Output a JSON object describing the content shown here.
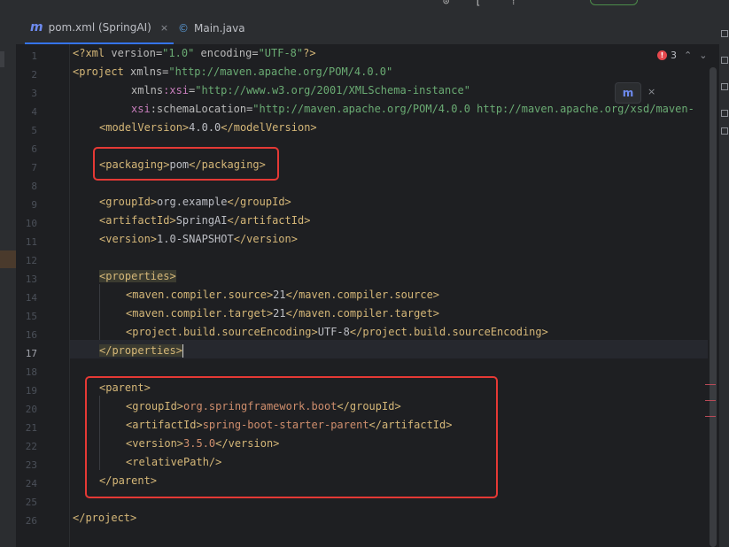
{
  "window": {
    "top_glyphs": [
      "⊙",
      "[",
      "⁞"
    ]
  },
  "tabs": [
    {
      "icon_label": "m",
      "label": "pom.xml (SpringAI)",
      "close": "×",
      "active": true
    },
    {
      "icon_label": "©",
      "label": "Main.java",
      "close": "",
      "active": false
    }
  ],
  "inspections": {
    "error_icon": "!",
    "error_count": "3",
    "up": "⌃",
    "down": "⌄"
  },
  "floating_toolbar": {
    "icon_label": "m",
    "close": "×"
  },
  "gutter": {
    "current_line": 17,
    "line_numbers": [
      "1",
      "2",
      "3",
      "4",
      "5",
      "6",
      "7",
      "8",
      "9",
      "10",
      "11",
      "12",
      "13",
      "14",
      "15",
      "16",
      "17",
      "18",
      "19",
      "20",
      "21",
      "22",
      "23",
      "24",
      "25",
      "26"
    ],
    "bulb": "💡"
  },
  "code": {
    "l1_a": "<?xml ",
    "l1_b": "version",
    "l1_c": "=",
    "l1_d": "\"1.0\"",
    "l1_e": " encoding",
    "l1_f": "=",
    "l1_g": "\"UTF-8\"",
    "l1_h": "?>",
    "l2_a": "<project ",
    "l2_b": "xmlns",
    "l2_c": "=",
    "l2_d": "\"http://maven.apache.org/POM/4.0.0\"",
    "l3_a": "xmlns",
    "l3_b": ":xsi",
    "l3_c": "=",
    "l3_d": "\"http://www.w3.org/2001/XMLSchema-instance\"",
    "l4_a": "xsi",
    "l4_b": ":schemaLocation",
    "l4_c": "=",
    "l4_d": "\"http://maven.apache.org/POM/4.0.0 http://maven.apache.org/xsd/maven-",
    "l5_a": "<modelVersion>",
    "l5_b": "4.0.0",
    "l5_c": "</modelVersion>",
    "l7_a": "<packaging>",
    "l7_b": "pom",
    "l7_c": "</packaging>",
    "l9_a": "<groupId>",
    "l9_b": "org.example",
    "l9_c": "</groupId>",
    "l10_a": "<artifactId>",
    "l10_b": "SpringAI",
    "l10_c": "</artifactId>",
    "l11_a": "<version>",
    "l11_b": "1.0-SNAPSHOT",
    "l11_c": "</version>",
    "l13_a": "<properties>",
    "l14_a": "<maven.compiler.source>",
    "l14_b": "21",
    "l14_c": "</maven.compiler.source>",
    "l15_a": "<maven.compiler.target>",
    "l15_b": "21",
    "l15_c": "</maven.compiler.target>",
    "l16_a": "<project.build.sourceEncoding>",
    "l16_b": "UTF-8",
    "l16_c": "</project.build.sourceEncoding>",
    "l17_a": "</properties>",
    "l19_a": "<parent>",
    "l20_a": "<groupId>",
    "l20_b": "org.springframework.boot",
    "l20_c": "</groupId>",
    "l21_a": "<artifactId>",
    "l21_b": "spring-boot-starter-parent",
    "l21_c": "</artifactId>",
    "l22_a": "<version>",
    "l22_b": "3.5.0",
    "l22_c": "</version>",
    "l23_a": "<relativePath/>",
    "l24_a": "</parent>",
    "l26_a": "</project>"
  },
  "colors": {
    "tag": "#d5b778",
    "attr_string": "#6aab73",
    "namespace": "#c77dbb",
    "unresolved_value": "#cf8e6d",
    "highlight_box": "#e53935",
    "active_tab_underline": "#3574f0"
  }
}
